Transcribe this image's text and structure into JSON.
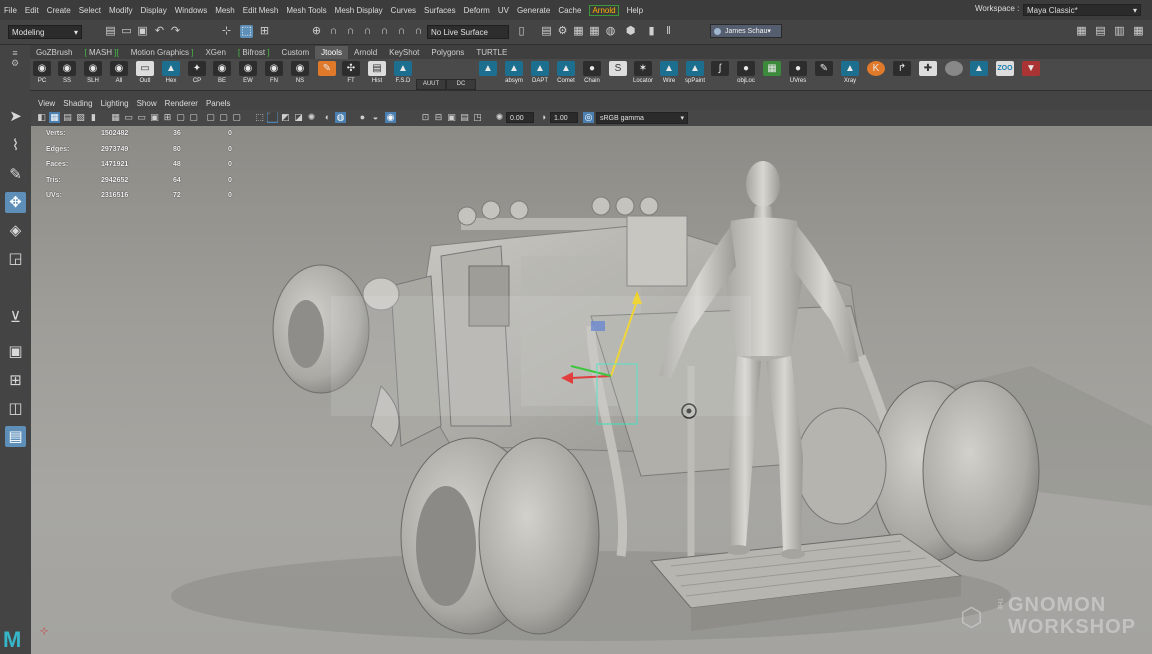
{
  "menubar": {
    "items": [
      "File",
      "Edit",
      "Create",
      "Select",
      "Modify",
      "Display",
      "Windows",
      "Mesh",
      "Edit Mesh",
      "Mesh Tools",
      "Mesh Display",
      "Curves",
      "Surfaces",
      "Deform",
      "UV",
      "Generate",
      "Cache",
      "Arnold",
      "Help"
    ],
    "workspace_label": "Workspace :",
    "workspace_value": "Maya Classic*"
  },
  "statusline": {
    "mode": "Modeling",
    "live_surface": "No Live Surface",
    "user": "James Schau"
  },
  "shelf": {
    "tabs": [
      "GoZBrush",
      "MASH",
      "Motion Graphics",
      "XGen",
      "Bifrost",
      "Custom",
      "Jtools",
      "Arnold",
      "KeyShot",
      "Polygons",
      "TURTLE"
    ],
    "active_tab": "Jtools",
    "buttons": [
      "PC",
      "SS",
      "SLH",
      "All",
      "Outl",
      "Hex",
      "CP",
      "BE",
      "EW",
      "FN",
      "NS",
      "FT",
      "Hist",
      "F.S.D",
      "absym",
      "DAPT",
      "Comet",
      "Chain",
      "Locator",
      "Wire",
      "spPaint",
      "objLoc",
      "UVres",
      "Xray"
    ],
    "small_buttons": [
      "AUUT",
      "DC"
    ]
  },
  "viewport": {
    "menu": [
      "View",
      "Shading",
      "Lighting",
      "Show",
      "Renderer",
      "Panels"
    ],
    "exposure": "0.00",
    "gamma": "1.00",
    "color_space": "sRGB gamma"
  },
  "hud": {
    "rows": [
      {
        "label": "Verts:",
        "total": "1502482",
        "selected": "36",
        "components": "0"
      },
      {
        "label": "Edges:",
        "total": "2973749",
        "selected": "80",
        "components": "0"
      },
      {
        "label": "Faces:",
        "total": "1471921",
        "selected": "48",
        "components": "0"
      },
      {
        "label": "Tris:",
        "total": "2942652",
        "selected": "64",
        "components": "0"
      },
      {
        "label": "UVs:",
        "total": "2316516",
        "selected": "72",
        "components": "0"
      }
    ]
  },
  "watermark": {
    "the": "THE",
    "line1": "GNOMON",
    "line2": "WORKSHOP"
  },
  "logo": "M",
  "colors": {
    "accent": "#5d8fb8",
    "arnold": "#ffb000",
    "shelf_bracket": "#46c246",
    "maya_logo": "#36b7c9"
  }
}
